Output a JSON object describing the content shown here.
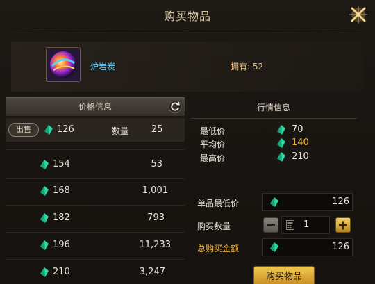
{
  "title": "购买物品",
  "item": {
    "name": "炉岩炭",
    "own_label": "拥有:",
    "own_count": "52"
  },
  "price_panel": {
    "header": "价格信息",
    "my_listing": {
      "sell_label": "出售",
      "price": "126",
      "qty_label": "数量",
      "qty": "25"
    },
    "orders": [
      {
        "price": "154",
        "qty": "53"
      },
      {
        "price": "168",
        "qty": "1,001"
      },
      {
        "price": "182",
        "qty": "793"
      },
      {
        "price": "196",
        "qty": "11,233"
      },
      {
        "price": "210",
        "qty": "3,247"
      }
    ]
  },
  "market_panel": {
    "header": "行情信息",
    "lowest_label": "最低价",
    "lowest": "70",
    "avg_label": "平均价",
    "avg": "140",
    "highest_label": "最高价",
    "highest": "210"
  },
  "purchase": {
    "unit_price_label": "单品最低价",
    "unit_price": "126",
    "qty_label": "购买数量",
    "qty": "1",
    "total_label": "总购买金额",
    "total": "126",
    "buy_button": "购买物品"
  },
  "colors": {
    "gem": "#2fd9a6",
    "gold": "#e6c07a",
    "accent": "#f0b43a"
  }
}
